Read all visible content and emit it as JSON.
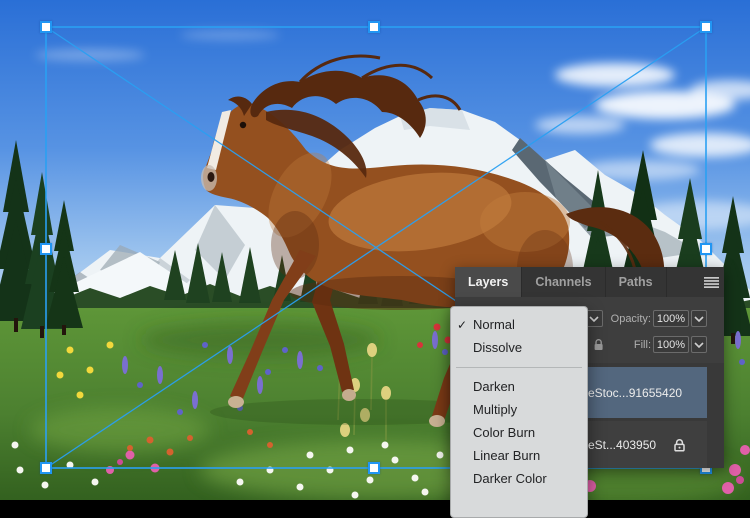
{
  "colors": {
    "selection_blue": "#2196f3",
    "panel_bg": "#3e3e3e",
    "tabbar_bg": "#343434",
    "active_tab_bg": "#4a4a4a",
    "selected_layer_bg": "#53677e",
    "menu_bg": "#d8dadb"
  },
  "layers_panel": {
    "tabs": [
      {
        "label": "Layers",
        "active": true
      },
      {
        "label": "Channels",
        "active": false
      },
      {
        "label": "Paths",
        "active": false
      }
    ],
    "opacity_label": "Opacity:",
    "opacity_value": "100%",
    "fill_label": "Fill:",
    "fill_value": "100%",
    "layers": [
      {
        "name": "eStoc...91655420",
        "selected": true,
        "locked": false
      },
      {
        "name": "eSt...403950",
        "selected": false,
        "locked": true
      }
    ]
  },
  "blend_mode_menu": {
    "check_glyph": "✓",
    "items": [
      {
        "label": "Normal",
        "checked": true
      },
      {
        "label": "Dissolve",
        "checked": false
      },
      {
        "label": "Darken",
        "checked": false
      },
      {
        "label": "Multiply",
        "checked": false
      },
      {
        "label": "Color Burn",
        "checked": false
      },
      {
        "label": "Linear Burn",
        "checked": false
      },
      {
        "label": "Darker Color",
        "checked": false
      }
    ]
  }
}
